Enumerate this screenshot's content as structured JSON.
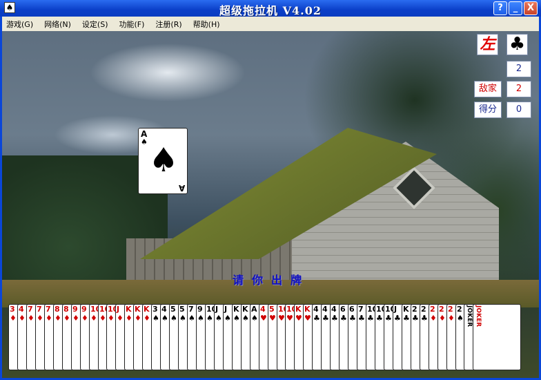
{
  "window": {
    "title": "超级拖拉机 V4.02",
    "buttons": {
      "help": "?",
      "minimize": "_",
      "close": "X"
    }
  },
  "menu": [
    {
      "label": "游戏(G)"
    },
    {
      "label": "网络(N)"
    },
    {
      "label": "设定(S)"
    },
    {
      "label": "功能(F)"
    },
    {
      "label": "注册(R)"
    },
    {
      "label": "帮助(H)"
    }
  ],
  "side_panel": {
    "position_label": "左",
    "trump_suit": "♣",
    "level_value": "2",
    "enemy_label": "敌家",
    "enemy_level": "2",
    "score_label": "得分",
    "score_value": "0"
  },
  "played_card": {
    "rank": "A",
    "suit": "♠",
    "color": "black"
  },
  "prompt": "请你出牌",
  "hand": [
    {
      "rank": "3",
      "suit": "♦",
      "color": "red"
    },
    {
      "rank": "4",
      "suit": "♦",
      "color": "red"
    },
    {
      "rank": "7",
      "suit": "♦",
      "color": "red"
    },
    {
      "rank": "7",
      "suit": "♦",
      "color": "red"
    },
    {
      "rank": "7",
      "suit": "♦",
      "color": "red"
    },
    {
      "rank": "8",
      "suit": "♦",
      "color": "red"
    },
    {
      "rank": "8",
      "suit": "♦",
      "color": "red"
    },
    {
      "rank": "9",
      "suit": "♦",
      "color": "red"
    },
    {
      "rank": "9",
      "suit": "♦",
      "color": "red"
    },
    {
      "rank": "10",
      "suit": "♦",
      "color": "red"
    },
    {
      "rank": "10",
      "suit": "♦",
      "color": "red"
    },
    {
      "rank": "10",
      "suit": "♦",
      "color": "red"
    },
    {
      "rank": "J",
      "suit": "♦",
      "color": "red"
    },
    {
      "rank": "K",
      "suit": "♦",
      "color": "red"
    },
    {
      "rank": "K",
      "suit": "♦",
      "color": "red"
    },
    {
      "rank": "K",
      "suit": "♦",
      "color": "red"
    },
    {
      "rank": "3",
      "suit": "♠",
      "color": "black"
    },
    {
      "rank": "4",
      "suit": "♠",
      "color": "black"
    },
    {
      "rank": "5",
      "suit": "♠",
      "color": "black"
    },
    {
      "rank": "5",
      "suit": "♠",
      "color": "black"
    },
    {
      "rank": "7",
      "suit": "♠",
      "color": "black"
    },
    {
      "rank": "9",
      "suit": "♠",
      "color": "black"
    },
    {
      "rank": "10",
      "suit": "♠",
      "color": "black"
    },
    {
      "rank": "J",
      "suit": "♠",
      "color": "black"
    },
    {
      "rank": "J",
      "suit": "♠",
      "color": "black"
    },
    {
      "rank": "K",
      "suit": "♠",
      "color": "black"
    },
    {
      "rank": "K",
      "suit": "♠",
      "color": "black"
    },
    {
      "rank": "A",
      "suit": "♠",
      "color": "black"
    },
    {
      "rank": "4",
      "suit": "♥",
      "color": "red"
    },
    {
      "rank": "5",
      "suit": "♥",
      "color": "red"
    },
    {
      "rank": "10",
      "suit": "♥",
      "color": "red"
    },
    {
      "rank": "10",
      "suit": "♥",
      "color": "red"
    },
    {
      "rank": "K",
      "suit": "♥",
      "color": "red"
    },
    {
      "rank": "K",
      "suit": "♥",
      "color": "red"
    },
    {
      "rank": "4",
      "suit": "♣",
      "color": "black"
    },
    {
      "rank": "4",
      "suit": "♣",
      "color": "black"
    },
    {
      "rank": "4",
      "suit": "♣",
      "color": "black"
    },
    {
      "rank": "6",
      "suit": "♣",
      "color": "black"
    },
    {
      "rank": "6",
      "suit": "♣",
      "color": "black"
    },
    {
      "rank": "7",
      "suit": "♣",
      "color": "black"
    },
    {
      "rank": "10",
      "suit": "♣",
      "color": "black"
    },
    {
      "rank": "10",
      "suit": "♣",
      "color": "black"
    },
    {
      "rank": "10",
      "suit": "♣",
      "color": "black"
    },
    {
      "rank": "J",
      "suit": "♣",
      "color": "black"
    },
    {
      "rank": "K",
      "suit": "♣",
      "color": "black"
    },
    {
      "rank": "2",
      "suit": "♣",
      "color": "black"
    },
    {
      "rank": "2",
      "suit": "♣",
      "color": "black"
    },
    {
      "rank": "2",
      "suit": "♦",
      "color": "red"
    },
    {
      "rank": "2",
      "suit": "♦",
      "color": "red"
    },
    {
      "rank": "2",
      "suit": "♦",
      "color": "red"
    },
    {
      "rank": "2",
      "suit": "♠",
      "color": "black"
    },
    {
      "rank": "JOKER",
      "suit": "",
      "color": "black"
    },
    {
      "rank": "JOKER",
      "suit": "",
      "color": "red"
    }
  ]
}
